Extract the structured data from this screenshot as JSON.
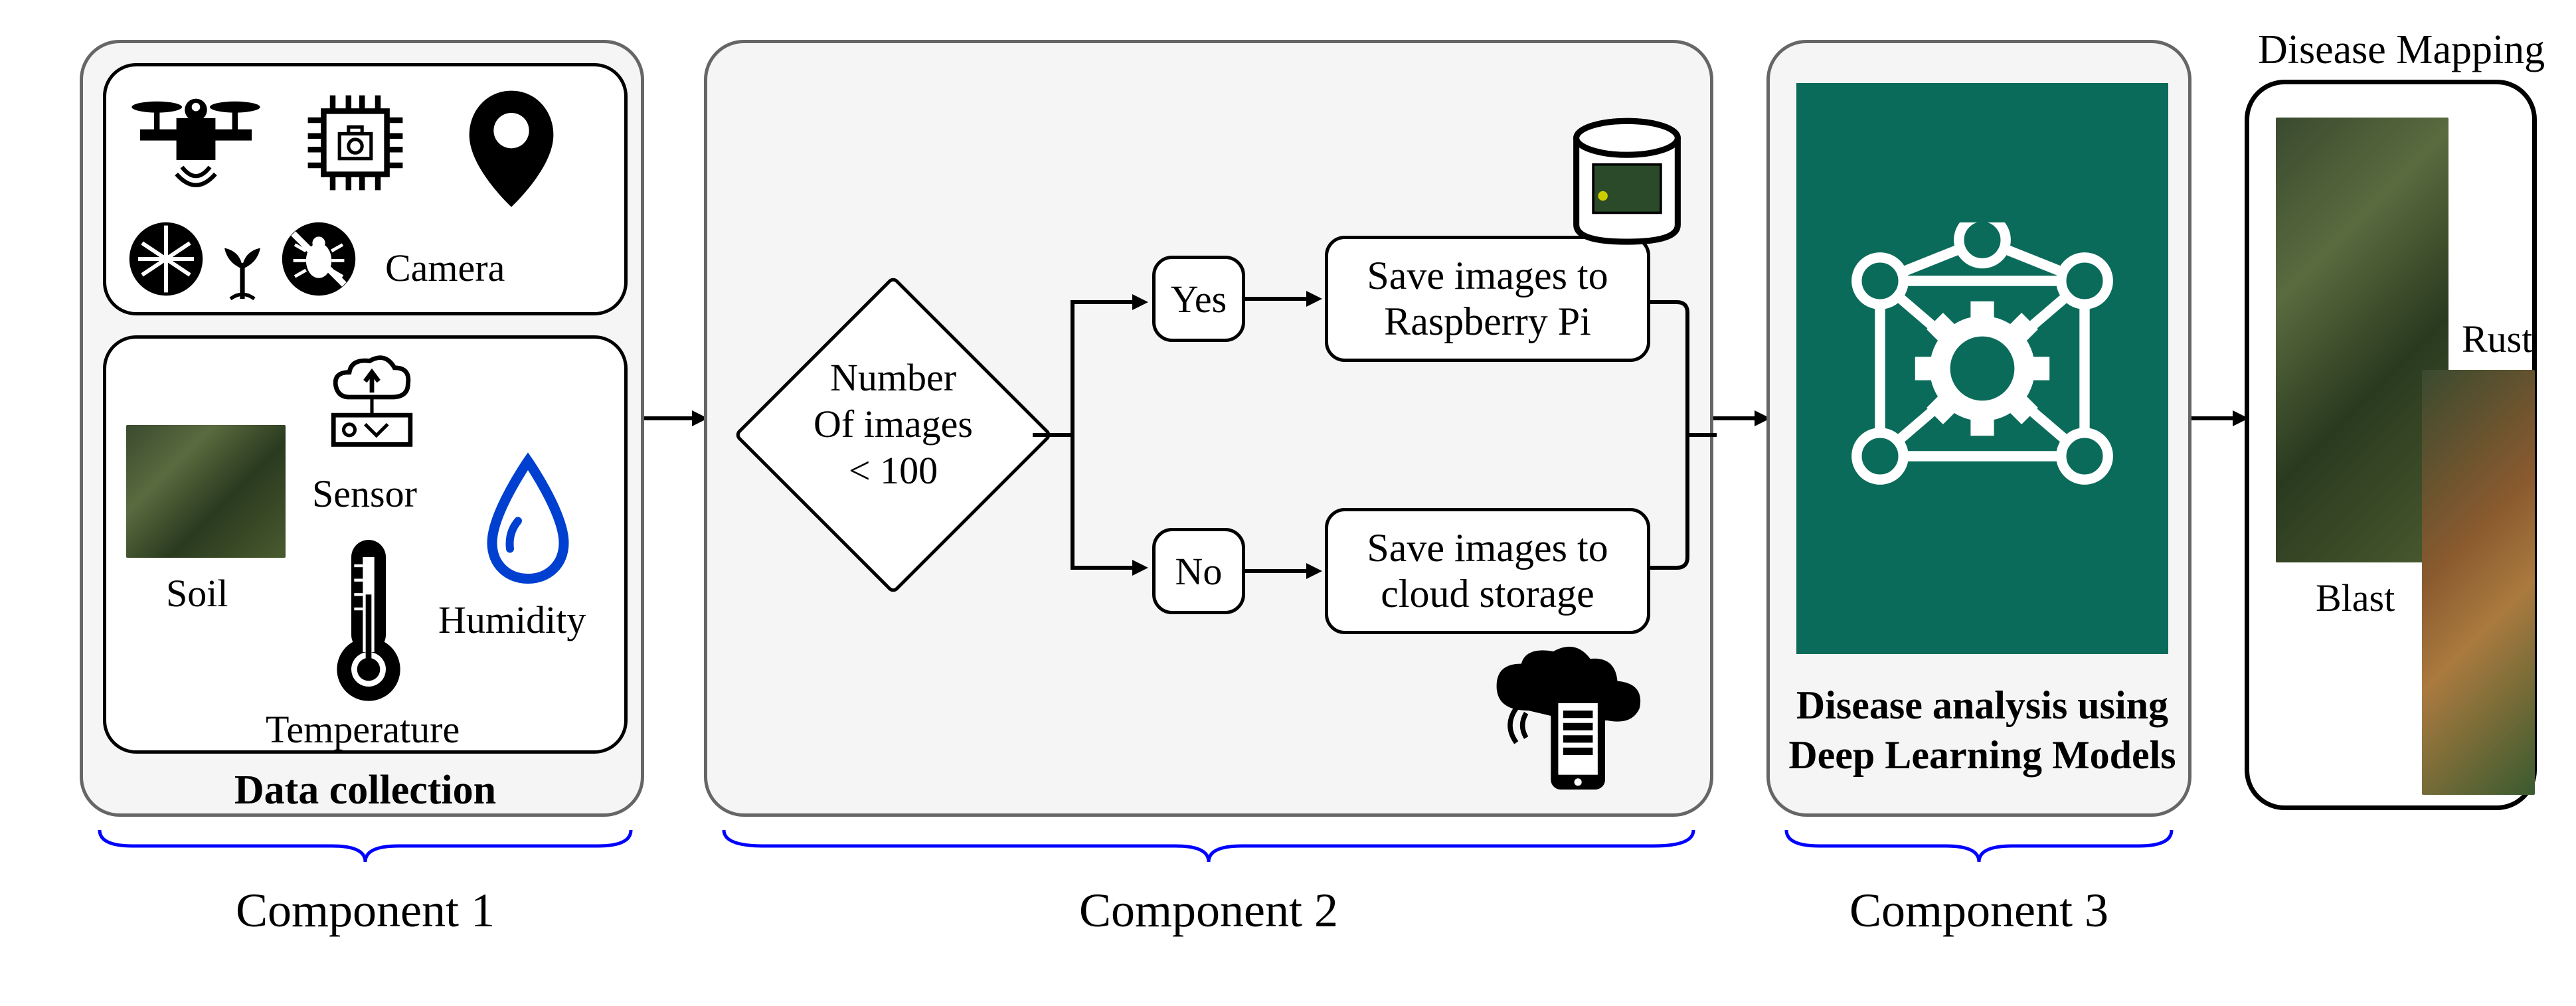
{
  "panel1": {
    "title": "Data collection",
    "camera_label": "Camera",
    "sensor_label": "Sensor",
    "soil_label": "Soil",
    "humidity_label": "Humidity",
    "temperature_label": "Temperature"
  },
  "panel2": {
    "decision_l1": "Number",
    "decision_l2": "Of images",
    "decision_l3": "< 100",
    "yes_label": "Yes",
    "no_label": "No",
    "save_pi_l1": "Save images to",
    "save_pi_l2": "Raspberry Pi",
    "save_cloud_l1": "Save images to",
    "save_cloud_l2": "cloud storage"
  },
  "panel3": {
    "title_l1": "Disease analysis using",
    "title_l2": "Deep Learning Models"
  },
  "panel4": {
    "title": "Disease Mapping",
    "blast_label": "Blast",
    "rust_label": "Rust"
  },
  "components": {
    "c1": "Component 1",
    "c2": "Component 2",
    "c3": "Component 3"
  }
}
